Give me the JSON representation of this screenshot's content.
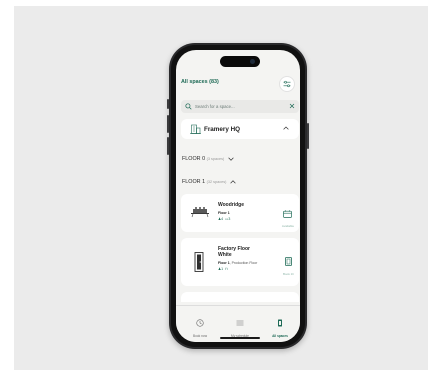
{
  "header": {
    "title": "All spaces (83)"
  },
  "search": {
    "placeholder": "Search for a space..."
  },
  "location": {
    "name": "Framery HQ"
  },
  "floors": [
    {
      "label": "FLOOR 0",
      "count": "(3 spaces)",
      "expanded": false
    },
    {
      "label": "FLOOR 1",
      "count": "(32 spaces)",
      "expanded": true
    }
  ],
  "spaces": [
    {
      "name_lines": [
        "Woodridge"
      ],
      "floor_label": "Floor 1",
      "floor_detail": "",
      "capacity": "4",
      "amenity": "3",
      "status": "Available"
    },
    {
      "name_lines": [
        "Factory Floor",
        "White"
      ],
      "floor_label": "Floor 1",
      "floor_detail": ", Production Floor",
      "capacity": "1",
      "amenity": "",
      "status": "Book 1h"
    }
  ],
  "tabs": [
    {
      "label": "Book now",
      "active": false
    },
    {
      "label": "My schedule",
      "active": false
    },
    {
      "label": "All spaces",
      "active": true
    }
  ],
  "colors": {
    "accent": "#1e6a56",
    "background": "#f4f4f2"
  }
}
